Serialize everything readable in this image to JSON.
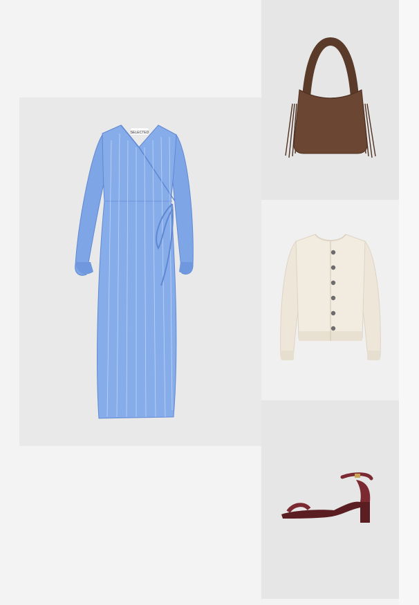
{
  "outfit": {
    "items": [
      {
        "id": "dress",
        "icon": "blue-wrap-dress-icon",
        "label_tag": "SELECTED",
        "colors": {
          "main": "#7ea6e6",
          "shade": "#5f88d2",
          "stripe": "#cfe0fa"
        }
      },
      {
        "id": "bag",
        "icon": "brown-suede-fringe-bag-icon",
        "colors": {
          "main": "#6b4633",
          "shade": "#4e3122"
        }
      },
      {
        "id": "cardigan",
        "icon": "cream-boucle-cardigan-icon",
        "colors": {
          "main": "#f2ece0",
          "shade": "#ddd3c2",
          "button": "#6d6d6d"
        }
      },
      {
        "id": "sandal",
        "icon": "burgundy-block-heel-sandal-icon",
        "colors": {
          "main": "#7b2a31",
          "shade": "#5a1d22"
        }
      }
    ]
  }
}
